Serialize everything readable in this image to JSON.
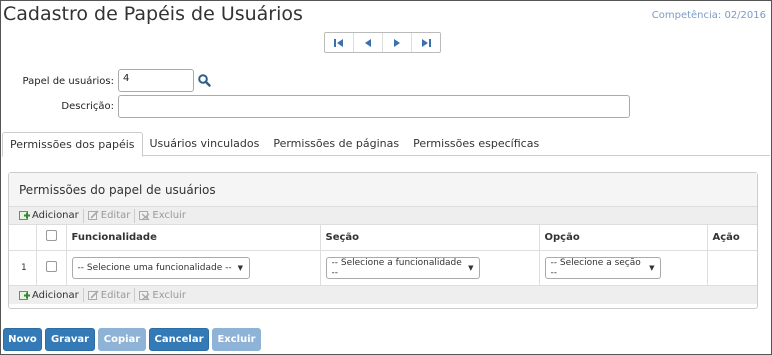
{
  "header": {
    "title": "Cadastro de Papéis de Usuários",
    "competencia": "Competência: 02/2016"
  },
  "nav": {
    "icons": [
      "first-record-icon",
      "previous-record-icon",
      "next-record-icon",
      "last-record-icon"
    ]
  },
  "form": {
    "papel_label": "Papel de usuários:",
    "papel_value": "4",
    "descricao_label": "Descrição:",
    "descricao_value": ""
  },
  "tabs": [
    {
      "label": "Permissões dos papéis",
      "active": true
    },
    {
      "label": "Usuários vinculados",
      "active": false
    },
    {
      "label": "Permissões de páginas",
      "active": false
    },
    {
      "label": "Permissões específicas",
      "active": false
    }
  ],
  "panel": {
    "title": "Permissões do papel de usuários",
    "toolbar": {
      "add": "Adicionar",
      "edit": "Editar",
      "delete": "Excluir"
    },
    "columns": {
      "funcionalidade": "Funcionalidade",
      "secao": "Seção",
      "opcao": "Opção",
      "acao": "Ação"
    },
    "rows": [
      {
        "num": "1",
        "funcionalidade": "-- Selecione uma funcionalidade --",
        "secao": "-- Selecione a funcionalidade --",
        "opcao": "-- Selecione a seção --"
      }
    ]
  },
  "buttons": {
    "novo": "Novo",
    "gravar": "Gravar",
    "copiar": "Copiar",
    "cancelar": "Cancelar",
    "excluir": "Excluir"
  },
  "colors": {
    "primary": "#337ab7",
    "primary_disabled": "#8fb3d7",
    "competencia": "#7a9cc4",
    "nav_icon": "#3a6fb0"
  }
}
